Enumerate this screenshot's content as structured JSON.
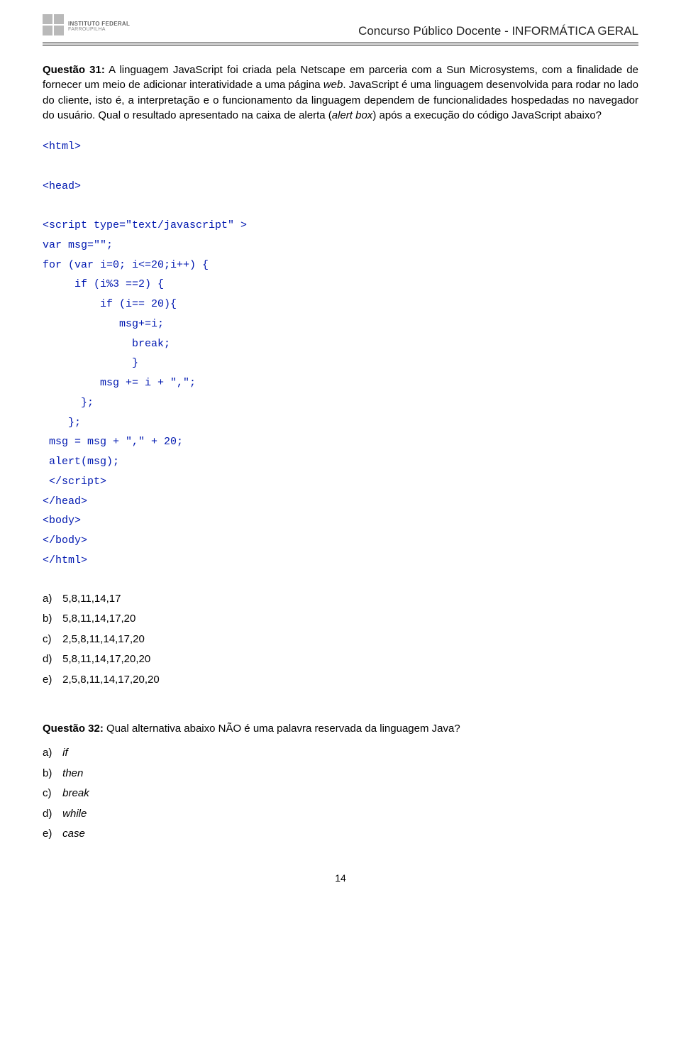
{
  "header": {
    "inst_line1": "INSTITUTO FEDERAL",
    "inst_line2": "FARROUPILHA",
    "title": "Concurso Público Docente - INFORMÁTICA GERAL"
  },
  "q31": {
    "label": "Questão 31:",
    "text_before_italics": " A linguagem JavaScript foi criada pela Netscape em parceria com a Sun Microsystems, com a finalidade de fornecer um meio de adicionar interatividade a uma página ",
    "web_italic": "web",
    "text_mid": ".  JavaScript é uma linguagem desenvolvida para rodar no lado do cliente, isto é, a interpretação e o funcionamento da linguagem dependem de funcionalidades hospedadas no navegador do usuário. Qual o resultado apresentado na caixa de alerta (",
    "alert_box_italic": "alert box",
    "text_after": ") após a execução do código JavaScript abaixo?"
  },
  "code": {
    "l1": "<html>",
    "l2": "<head>",
    "l3": "<script type=\"text/javascript\" >",
    "l4": "var msg=\"\";",
    "l5": "for (var i=0; i<=20;i++) {",
    "l6": "     if (i%3 ==2) {",
    "l7": "         if (i== 20){",
    "l8": "            msg+=i;",
    "l9": "              break;",
    "l10": "              }",
    "l11": "         msg += i + \",\";",
    "l12": "      };",
    "l13": "    };",
    "l14": " msg = msg + \",\" + 20;",
    "l15": " alert(msg);",
    "l16": " </script>",
    "l17": "</head>",
    "l18": "<body>",
    "l19": "</body>",
    "l20": "</html>"
  },
  "q31_options": {
    "a": {
      "label": "a)",
      "text": "5,8,11,14,17"
    },
    "b": {
      "label": "b)",
      "text": "5,8,11,14,17,20"
    },
    "c": {
      "label": "c)",
      "text": "2,5,8,11,14,17,20"
    },
    "d": {
      "label": "d)",
      "text": "5,8,11,14,17,20,20"
    },
    "e": {
      "label": "e)",
      "text": "2,5,8,11,14,17,20,20"
    }
  },
  "q32": {
    "label": "Questão 32:",
    "text": " Qual alternativa abaixo NÃO é uma palavra reservada da linguagem Java?"
  },
  "q32_options": {
    "a": {
      "label": "a)",
      "text": "if"
    },
    "b": {
      "label": "b)",
      "text": "then"
    },
    "c": {
      "label": "c)",
      "text": "break"
    },
    "d": {
      "label": "d)",
      "text": "while"
    },
    "e": {
      "label": "e)",
      "text": "case"
    }
  },
  "page_number": "14"
}
